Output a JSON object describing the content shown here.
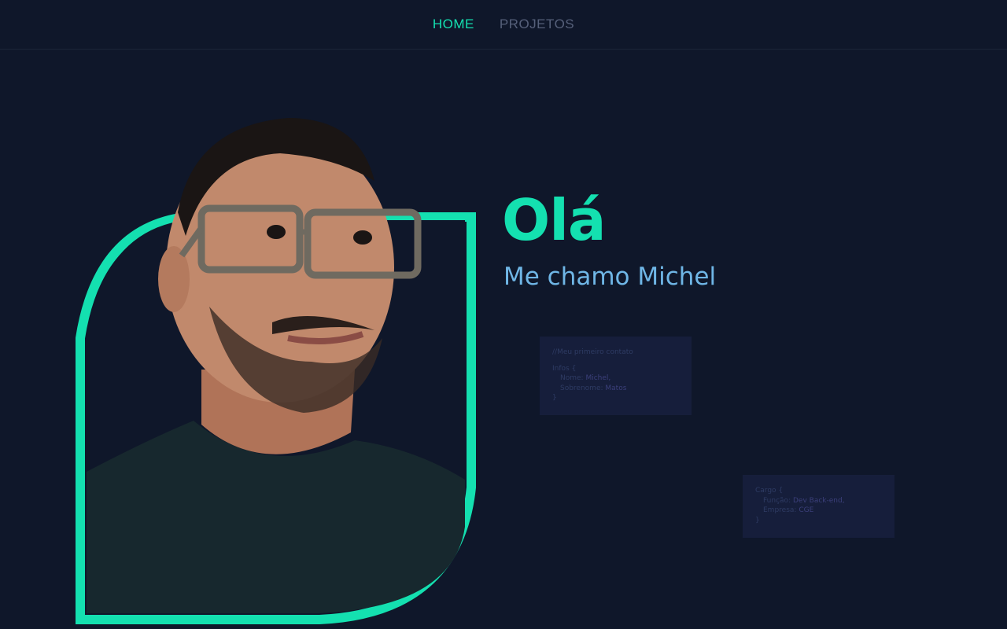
{
  "nav": {
    "items": [
      {
        "label": "HOME",
        "active": true
      },
      {
        "label": "PROJETOS",
        "active": false
      }
    ]
  },
  "hero": {
    "title": "Olá",
    "subtitle": "Me chamo Michel"
  },
  "code_card_1": {
    "comment": "//Meu primeiro contato",
    "object_name": "Infos",
    "open": "{",
    "fields": [
      {
        "key": "Nome:",
        "value": "Michel,"
      },
      {
        "key": "Sobrenome:",
        "value": "Matos"
      }
    ],
    "close": "}"
  },
  "code_card_2": {
    "object_name": "Cargo",
    "open": "{",
    "fields": [
      {
        "key": "Função:",
        "value": "Dev Back-end,"
      },
      {
        "key": "Empresa:",
        "value": "CGE"
      }
    ],
    "close": "}"
  },
  "colors": {
    "background": "#0f172a",
    "accent": "#14e0b0",
    "subtitle": "#6fb6e6",
    "nav_inactive": "#56607a"
  }
}
